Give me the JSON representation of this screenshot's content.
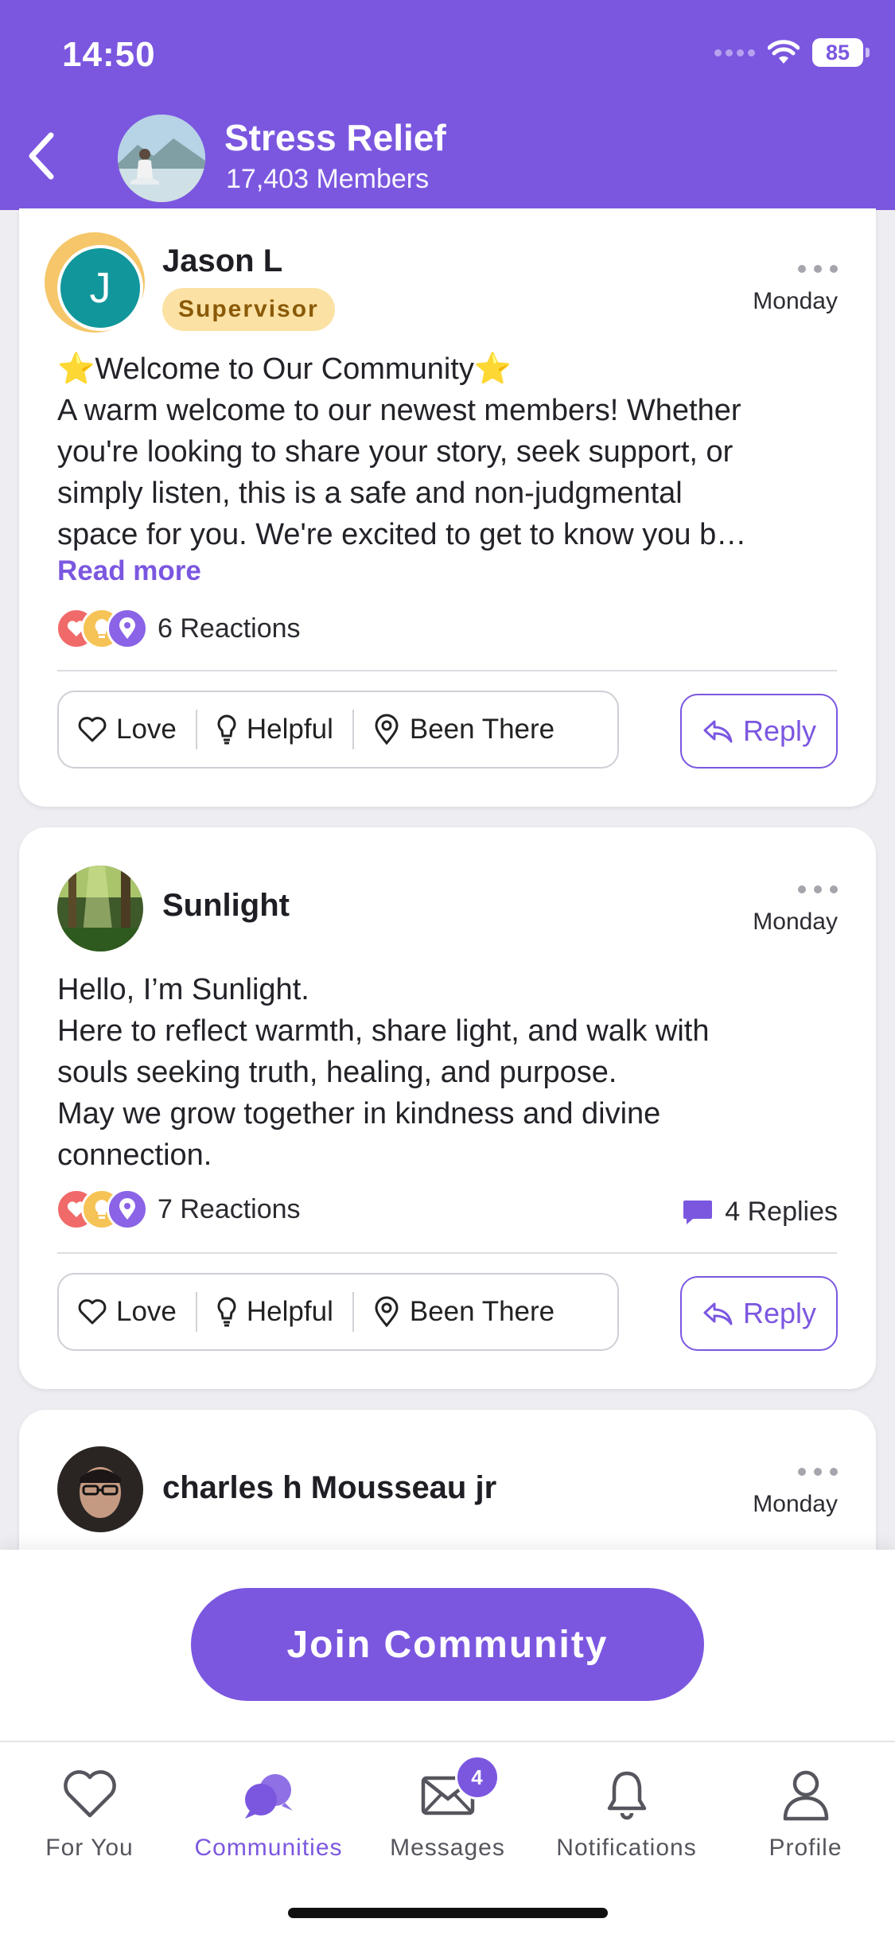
{
  "status_bar": {
    "time": "14:50",
    "battery": "85"
  },
  "header": {
    "title": "Stress Relief",
    "members": "17,403 Members"
  },
  "posts": [
    {
      "avatar_letter": "J",
      "author": "Jason L",
      "badge": "Supervisor",
      "date": "Monday",
      "lines": [
        "⭐Welcome to Our Community⭐",
        "A warm welcome to our newest members!  Whether",
        "you're looking to share your story, seek support, or",
        "simply listen, this is a safe and non-judgmental",
        "space for you.  We're excited to get to know you b…"
      ],
      "read_more": "Read more",
      "reactions": "6 Reactions"
    },
    {
      "author": "Sunlight",
      "date": "Monday",
      "lines": [
        "Hello, I’m Sunlight.",
        "Here to reflect warmth, share light, and walk with",
        "souls seeking truth, healing, and purpose.",
        "May we grow together in kindness and divine",
        "connection."
      ],
      "reactions": "7 Reactions",
      "replies": "4 Replies"
    },
    {
      "author": "charles h Mousseau jr",
      "date": "Monday"
    }
  ],
  "actions": {
    "love": "Love",
    "helpful": "Helpful",
    "been_there": "Been There",
    "reply": "Reply"
  },
  "join_button": "Join Community",
  "tabs": {
    "for_you": "For You",
    "communities": "Communities",
    "messages": "Messages",
    "messages_badge": "4",
    "notifications": "Notifications",
    "profile": "Profile"
  },
  "colors": {
    "accent": "#7b57e0",
    "badge_bg": "#fbe2a4",
    "love": "#f06a6a",
    "helpful": "#f6c356"
  }
}
